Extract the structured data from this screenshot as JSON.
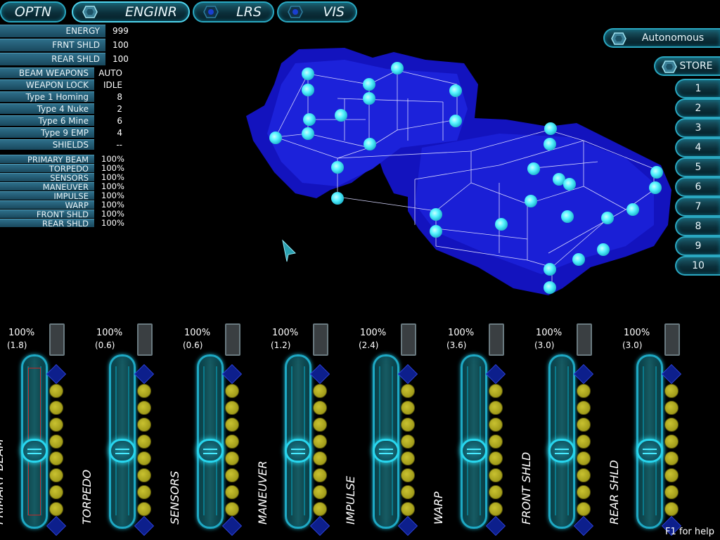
{
  "tabs": [
    {
      "label": "OPTN"
    },
    {
      "label": "ENGINR"
    },
    {
      "label": "LRS"
    },
    {
      "label": "VIS"
    }
  ],
  "stats_main": [
    {
      "label": "ENERGY",
      "value": "999"
    },
    {
      "label": "FRNT SHLD",
      "value": "100"
    },
    {
      "label": "REAR SHLD",
      "value": "100"
    }
  ],
  "stats_weapons": [
    {
      "label": "BEAM WEAPONS",
      "value": "AUTO"
    },
    {
      "label": "WEAPON LOCK",
      "value": "IDLE"
    },
    {
      "label": "Type 1 Homing",
      "value": "8"
    },
    {
      "label": "Type 4 Nuke",
      "value": "2"
    },
    {
      "label": "Type 6 Mine",
      "value": "6"
    },
    {
      "label": "Type 9 EMP",
      "value": "4"
    },
    {
      "label": "SHIELDS",
      "value": "--"
    }
  ],
  "stats_systems": [
    {
      "label": "PRIMARY BEAM",
      "value": "100%"
    },
    {
      "label": "TORPEDO",
      "value": "100%"
    },
    {
      "label": "SENSORS",
      "value": "100%"
    },
    {
      "label": "MANEUVER",
      "value": "100%"
    },
    {
      "label": "IMPULSE",
      "value": "100%"
    },
    {
      "label": "WARP",
      "value": "100%"
    },
    {
      "label": "FRONT SHLD",
      "value": "100%"
    },
    {
      "label": "REAR SHLD",
      "value": "100%"
    }
  ],
  "right": {
    "autonomous_label": "Autonomous",
    "store_label": "STORE",
    "slots": [
      "1",
      "2",
      "3",
      "4",
      "5",
      "6",
      "7",
      "8",
      "9",
      "10"
    ]
  },
  "systems": [
    {
      "name": "PRIMARY BEAM",
      "percent": "100%",
      "coolant": "(1.8)",
      "level": 0.5,
      "dots": 8,
      "selected": true
    },
    {
      "name": "TORPEDO",
      "percent": "100%",
      "coolant": "(0.6)",
      "level": 0.5,
      "dots": 8,
      "selected": false
    },
    {
      "name": "SENSORS",
      "percent": "100%",
      "coolant": "(0.6)",
      "level": 0.5,
      "dots": 8,
      "selected": false
    },
    {
      "name": "MANEUVER",
      "percent": "100%",
      "coolant": "(1.2)",
      "level": 0.5,
      "dots": 8,
      "selected": false
    },
    {
      "name": "IMPULSE",
      "percent": "100%",
      "coolant": "(2.4)",
      "level": 0.5,
      "dots": 8,
      "selected": false
    },
    {
      "name": "WARP",
      "percent": "100%",
      "coolant": "(3.6)",
      "level": 0.5,
      "dots": 8,
      "selected": false
    },
    {
      "name": "FRONT SHLD",
      "percent": "100%",
      "coolant": "(3.0)",
      "level": 0.5,
      "dots": 8,
      "selected": false
    },
    {
      "name": "REAR SHLD",
      "percent": "100%",
      "coolant": "(3.0)",
      "level": 0.5,
      "dots": 8,
      "selected": false
    }
  ],
  "help_text": "F1 for help",
  "colors": {
    "accent": "#2aa7c0",
    "hull": "#1a1ad0",
    "node": "#55f2ff",
    "coolant_dot": "#b8b020"
  }
}
